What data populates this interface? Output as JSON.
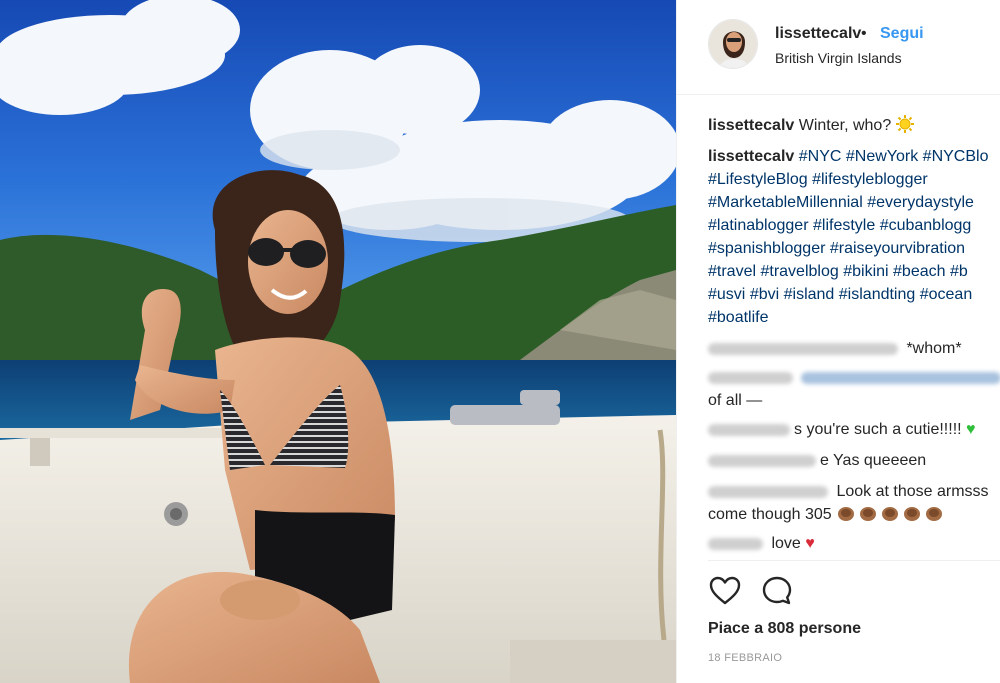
{
  "photo": {
    "alt_subject": "woman in striped bikini top sitting on a boat, sunglasses, blue sky with clouds and green island behind",
    "icon": "post-photo"
  },
  "post_header": {
    "username": "lissettecalv",
    "separator": "•",
    "follow_label": "Segui",
    "location": "British Virgin Islands"
  },
  "comments": [
    {
      "user": "lissettecalv",
      "text": "Winter, who?",
      "icon": "sun-icon"
    },
    {
      "user": "lissettecalv",
      "hashtag_lines": [
        [
          "#NYC",
          "#NewYork",
          "#NYCBlo"
        ],
        [
          "#LifestyleBlog",
          "#lifestyleblogger"
        ],
        [
          "#MarketableMillennial",
          "#everydaystyle"
        ],
        [
          "#latinablogger",
          "#lifestyle",
          "#cubanblogg"
        ],
        [
          "#spanishblogger",
          "#raiseyourvibration"
        ],
        [
          "#travel",
          "#travelblog",
          "#bikini",
          "#beach",
          "#b"
        ],
        [
          "#usvi",
          "#bvi",
          "#island",
          "#islandting",
          "#ocean"
        ],
        [
          "#boatlife"
        ]
      ]
    },
    {
      "user_hidden": true,
      "text": "*whom*"
    },
    {
      "user_hidden": true,
      "mention_hidden": true,
      "text": "of all —"
    },
    {
      "user_hidden": true,
      "text": "s you're such a cutie!!!!!",
      "icon": "green-heart-icon",
      "heart_glyph": "♥"
    },
    {
      "user_hidden": true,
      "text": "e Yas queeeen"
    },
    {
      "user_hidden": true,
      "text": "Look at those armsss",
      "text2": "come though 305",
      "icon": "clapping-hands-icon",
      "icon_count": 5
    },
    {
      "user_hidden": true,
      "text": "love",
      "icon": "red-heart-icon",
      "heart_glyph": "♥"
    }
  ],
  "actions": {
    "like_icon": "heart-outline-icon",
    "comment_icon": "comment-bubble-icon"
  },
  "likes_text": "Piace a 808 persone",
  "date_text": "18 FEBBRAIO",
  "colors": {
    "link_blue": "#3897f0",
    "hashtag": "#003569",
    "text": "#262626",
    "muted": "#999999",
    "divider": "#efefef"
  }
}
